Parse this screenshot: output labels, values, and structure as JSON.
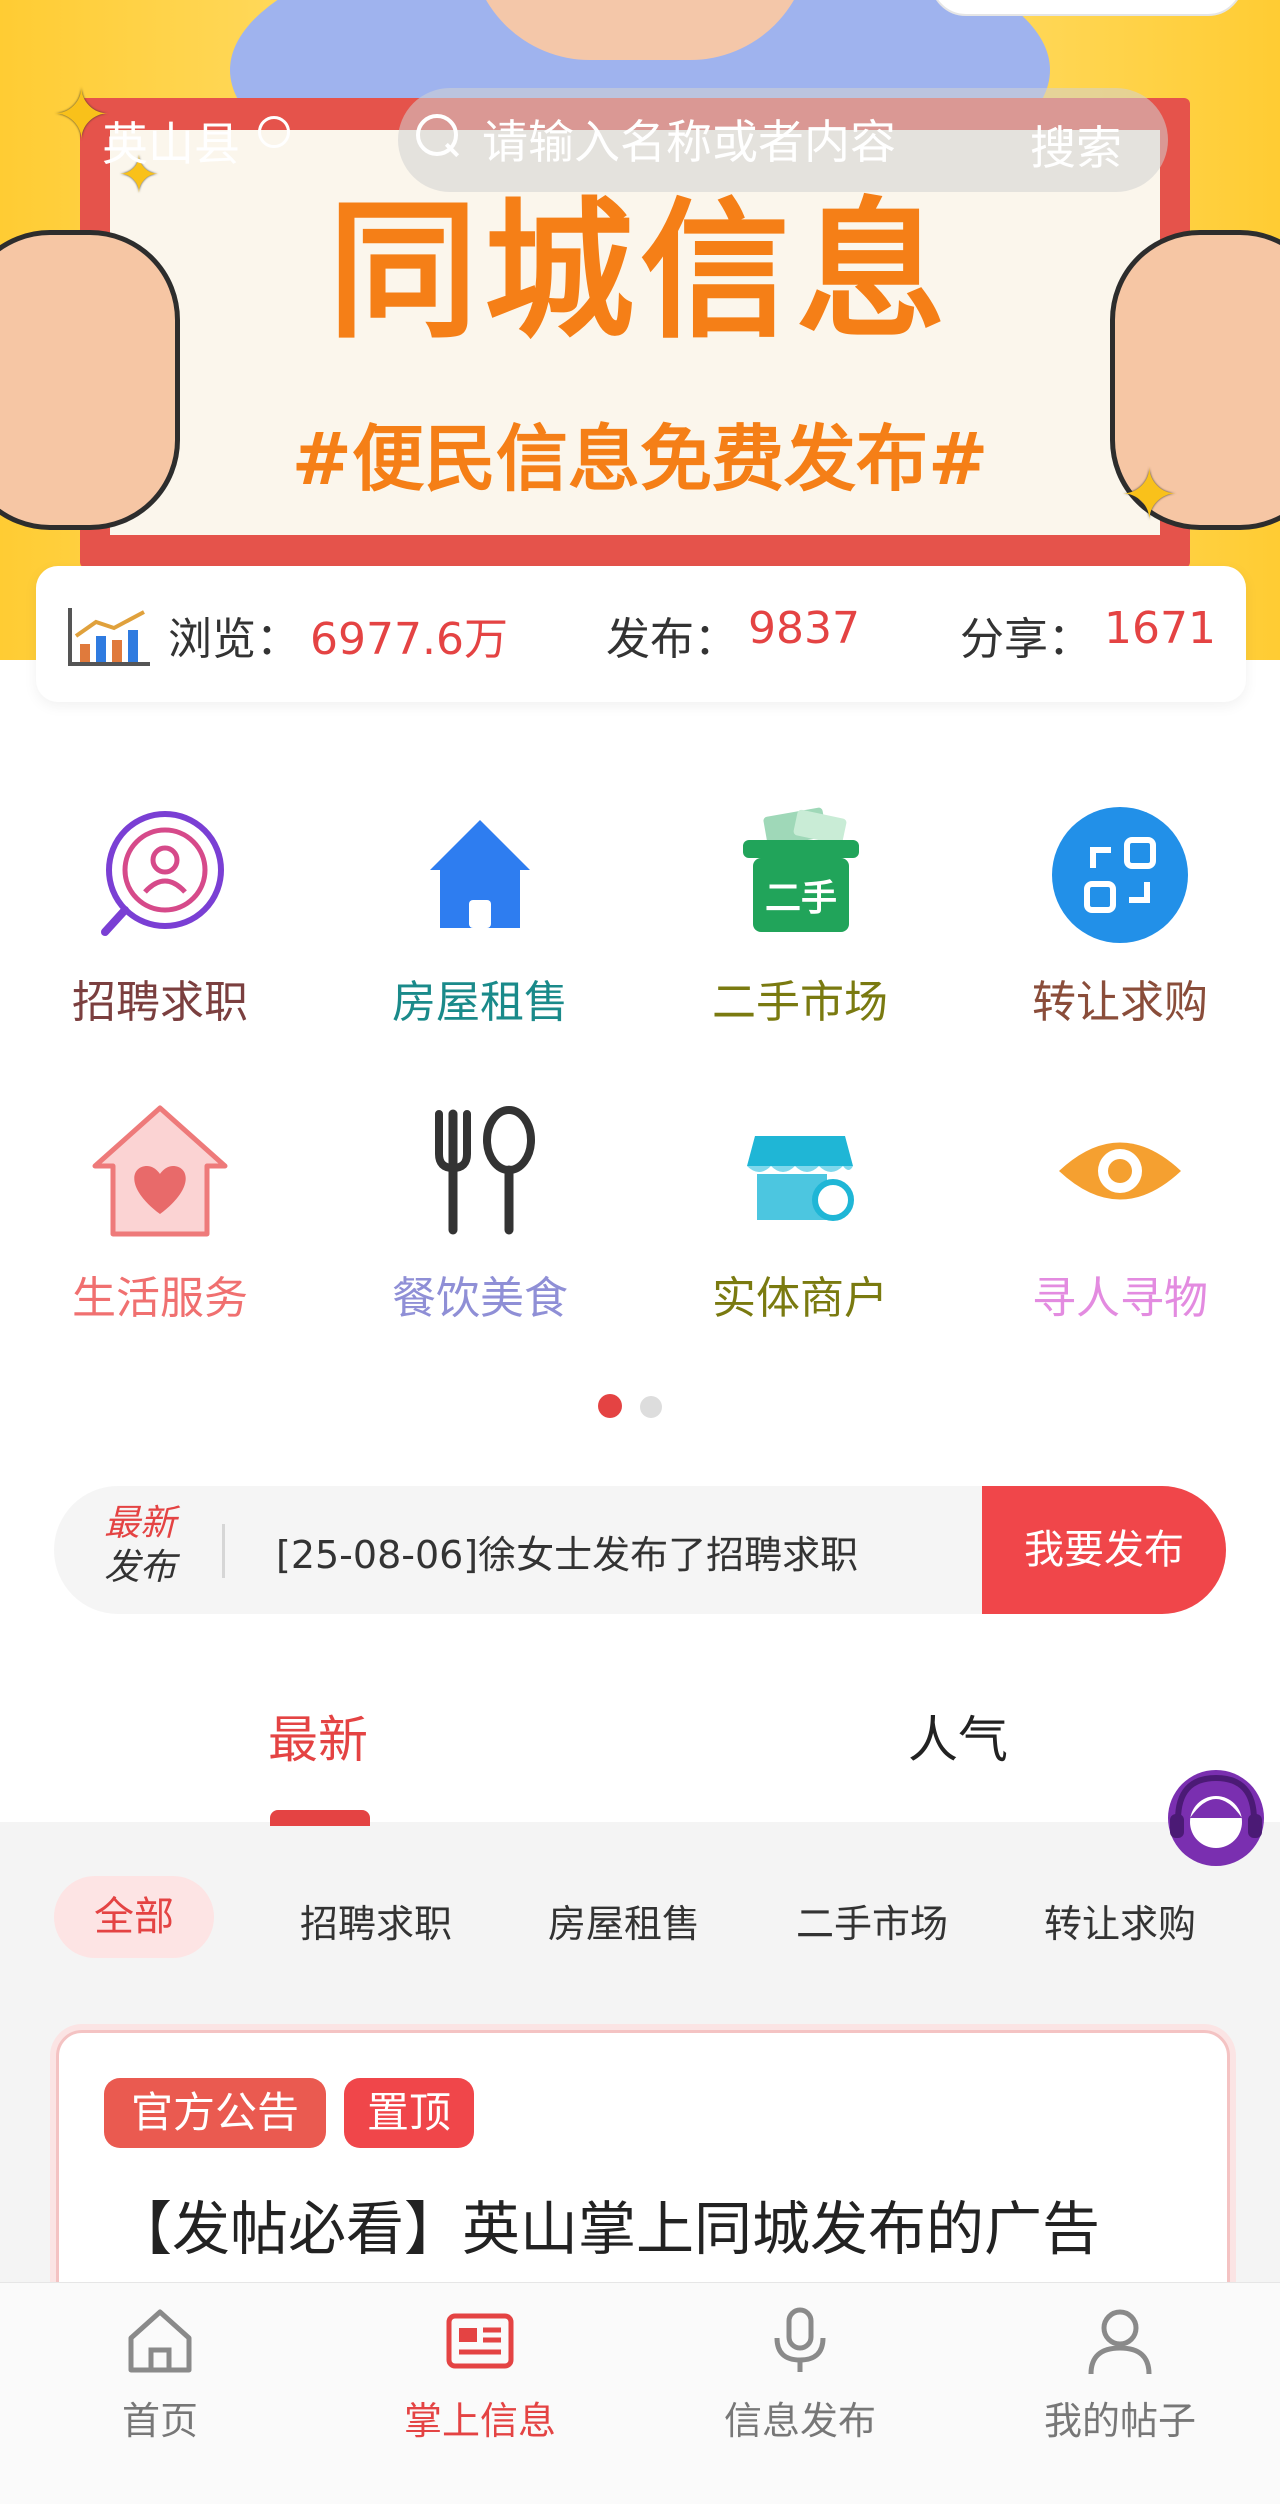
{
  "header": {
    "city": "英山县",
    "search_placeholder": "请输入名称或者内容",
    "search_button": "搜索"
  },
  "banner": {
    "title": "同城信息",
    "subtitle": "#便民信息免费发布#"
  },
  "stats": {
    "views_label": "浏览：",
    "views_value": "6977.6万",
    "posts_label": "发布：",
    "posts_value": "9837",
    "shares_label": "分享：",
    "shares_value": "1671"
  },
  "categories": [
    {
      "label": "招聘求职",
      "icon": "job-search-icon",
      "color": "#7b3f3f"
    },
    {
      "label": "房屋租售",
      "icon": "house-icon",
      "color": "#1a8a8a"
    },
    {
      "label": "二手市场",
      "icon": "second-hand-basket-icon",
      "color": "#7a7a10"
    },
    {
      "label": "转让求购",
      "icon": "transfer-icon",
      "color": "#8a4d3a"
    },
    {
      "label": "生活服务",
      "icon": "heart-house-icon",
      "color": "#f07070"
    },
    {
      "label": "餐饮美食",
      "icon": "fork-spoon-icon",
      "color": "#8f8fd6"
    },
    {
      "label": "实体商户",
      "icon": "store-icon",
      "color": "#7a7a10"
    },
    {
      "label": "寻人寻物",
      "icon": "eye-icon",
      "color": "#e38be0"
    }
  ],
  "notice": {
    "tag_line1": "最新",
    "tag_line2": "发布",
    "text": "[25-08-06]徐女士发布了招聘求职",
    "button": "我要发布"
  },
  "tabs": [
    {
      "label": "最新",
      "active": true
    },
    {
      "label": "人气",
      "active": false
    }
  ],
  "filters": [
    "全部",
    "招聘求职",
    "房屋租售",
    "二手市场",
    "转让求购"
  ],
  "card": {
    "badge_official": "官方公告",
    "badge_top": "置顶",
    "title": "【发帖必看】英山掌上同城发布的广告"
  },
  "bottom_nav": [
    {
      "label": "首页",
      "icon": "home-icon",
      "active": false
    },
    {
      "label": "掌上信息",
      "icon": "news-icon",
      "active": true
    },
    {
      "label": "信息发布",
      "icon": "microphone-icon",
      "active": false
    },
    {
      "label": "我的帖子",
      "icon": "user-icon",
      "active": false
    }
  ],
  "colors": {
    "accent": "#e44343",
    "orange": "#f57f17"
  }
}
